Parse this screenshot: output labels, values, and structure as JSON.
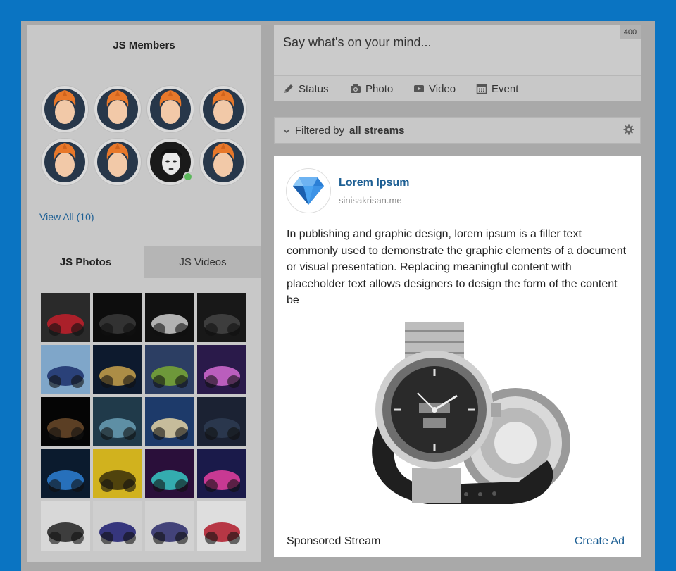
{
  "members": {
    "title": "JS Members",
    "view_all": "View All (10)"
  },
  "media_tabs": {
    "photos": "JS Photos",
    "videos": "JS Videos"
  },
  "composer": {
    "placeholder": "Say what's on your mind...",
    "char_count": "400",
    "actions": {
      "status": "Status",
      "photo": "Photo",
      "video": "Video",
      "event": "Event"
    }
  },
  "filter": {
    "prefix": "Filtered by",
    "value": "all streams"
  },
  "ad": {
    "title": "Lorem Ipsum",
    "site": "sinisakrisan.me",
    "body": "In publishing and graphic design, lorem ipsum is a filler text commonly used to demonstrate the graphic elements of a document or visual presentation. Replacing meaningful content with placeholder text allows designers to design the form of the content be",
    "footer_label": "Sponsored Stream",
    "create_ad": "Create Ad"
  },
  "colors": {
    "page_background": "#0a74c2",
    "link": "#1d5f94",
    "online": "#5cb85c"
  }
}
